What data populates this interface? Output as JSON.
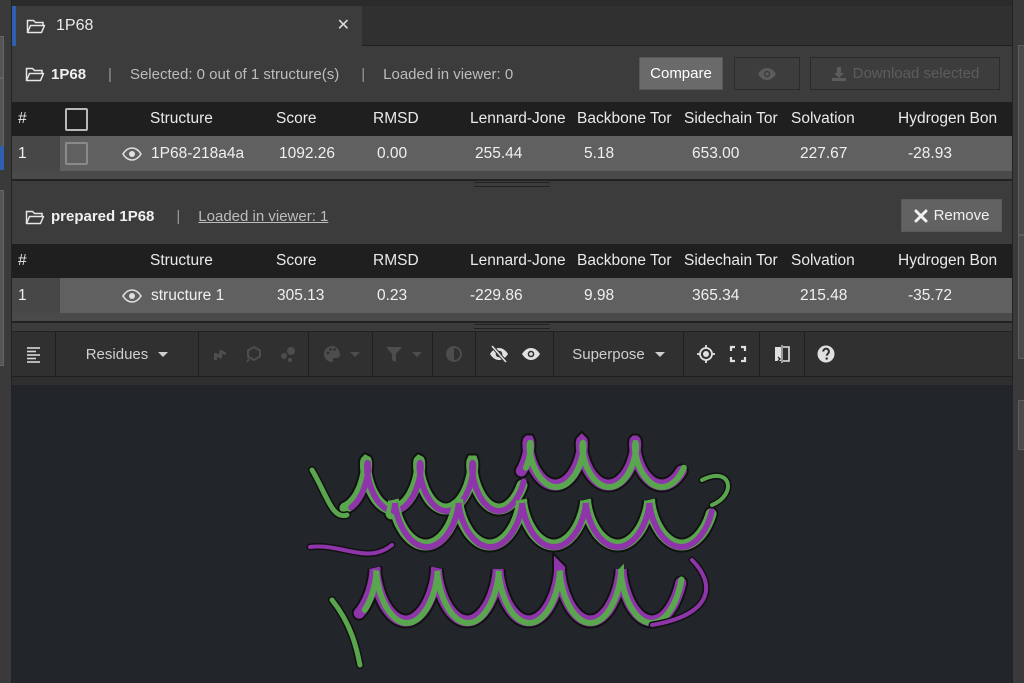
{
  "tab": {
    "title": "1P68",
    "close_icon": "close-icon"
  },
  "colors": {
    "accent": "#2f5fb0",
    "ribbon_green": "#5aa64f",
    "ribbon_purple": "#8e35aa",
    "viewer_bg": "#22252a"
  },
  "section1": {
    "name": "1P68",
    "selected_text": "Selected: 0 out of 1 structure(s)",
    "loaded_text": "Loaded in viewer: 0",
    "compare_label": "Compare",
    "view_icon": "eye-icon",
    "download_label": "Download selected",
    "columns": [
      "#",
      "",
      "Structure",
      "Score",
      "RMSD",
      "Lennard-Jone",
      "Backbone Tor",
      "Sidechain Tor",
      "Solvation",
      "Hydrogen Bon"
    ],
    "rows": [
      {
        "index": "1",
        "checked": false,
        "structure": "1P68-218a4a",
        "score": "1092.26",
        "rmsd": "0.00",
        "lj": "255.44",
        "backbone": "5.18",
        "sidechain": "653.00",
        "solvation": "227.67",
        "hbond": "-28.93"
      }
    ]
  },
  "section2": {
    "name": "prepared 1P68",
    "loaded_text": "Loaded in viewer: 1",
    "remove_label": "Remove",
    "columns": [
      "#",
      "Structure",
      "Score",
      "RMSD",
      "Lennard-Jone",
      "Backbone Tor",
      "Sidechain Tor",
      "Solvation",
      "Hydrogen Bon"
    ],
    "rows": [
      {
        "index": "1",
        "structure": "structure 1",
        "score": "305.13",
        "rmsd": "0.23",
        "lj": "-229.86",
        "backbone": "9.98",
        "sidechain": "365.34",
        "solvation": "215.48",
        "hbond": "-35.72"
      }
    ]
  },
  "toolbar": {
    "residues_label": "Residues",
    "superpose_label": "Superpose",
    "icons": [
      "sequence-panel-icon",
      "ribbon-icon",
      "surface-icon",
      "spheres-icon",
      "palette-icon",
      "filter-icon",
      "contrast-icon",
      "hide-icon",
      "show-icon",
      "center-icon",
      "fullscreen-icon",
      "split-view-icon",
      "help-icon"
    ]
  },
  "viewer": {
    "content": "superposed protein ribbon (helical bundle)"
  }
}
